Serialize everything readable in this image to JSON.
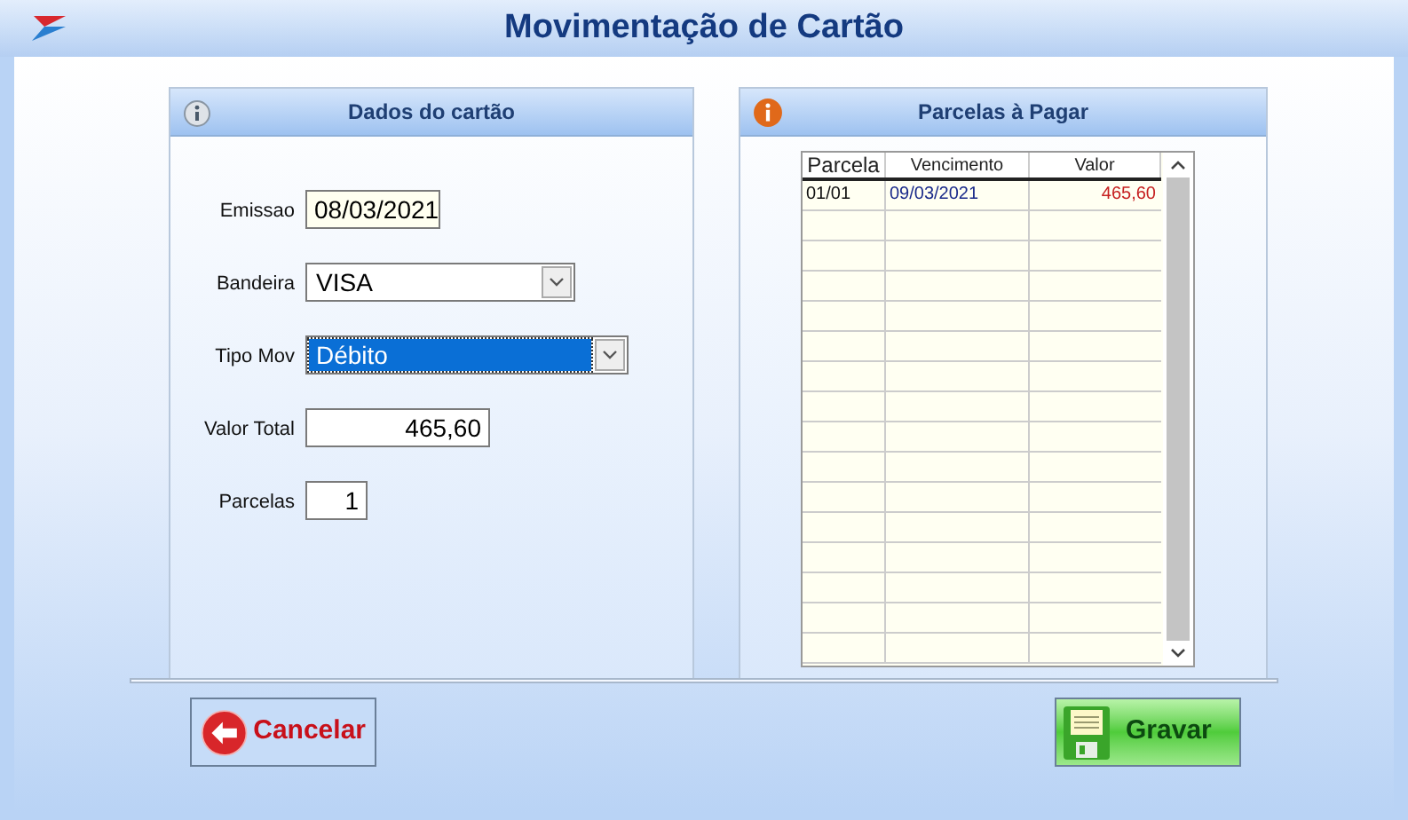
{
  "window": {
    "title": "Movimentação de Cartão"
  },
  "card_panel": {
    "title": "Dados do cartão",
    "fields": [
      {
        "label": "Emissao",
        "value": "08/03/2021",
        "kind": "date"
      },
      {
        "label": "Bandeira",
        "value": "VISA",
        "kind": "select",
        "selected": false
      },
      {
        "label": "Tipo Mov",
        "value": "Débito",
        "kind": "select",
        "selected": true
      },
      {
        "label": "Valor Total",
        "value": "465,60",
        "kind": "amount"
      },
      {
        "label": "Parcelas",
        "value": "1",
        "kind": "count"
      }
    ]
  },
  "installments_panel": {
    "title": "Parcelas à Pagar",
    "table": {
      "columns": [
        "Parcela",
        "Vencimento",
        "Valor"
      ],
      "rows": [
        {
          "parcela": "01/01",
          "vencimento": "09/03/2021",
          "valor": "465,60"
        }
      ]
    }
  },
  "buttons": [
    {
      "label": "Cancelar",
      "kind": "cancel"
    },
    {
      "label": "Gravar",
      "kind": "save"
    }
  ]
}
